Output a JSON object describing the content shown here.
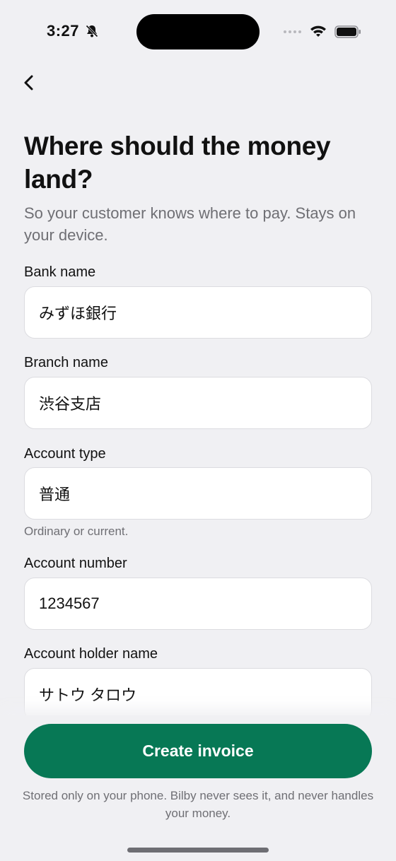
{
  "status_bar": {
    "time": "3:27",
    "icons": [
      "bell-slash-icon",
      "signal-dots-icon",
      "wifi-icon",
      "battery-icon"
    ]
  },
  "nav": {
    "back_icon": "chevron-left-icon"
  },
  "header": {
    "title": "Where should the money land?",
    "subtitle": "So your customer knows where to pay. Stays on your device."
  },
  "form": {
    "bank_name": {
      "label": "Bank name",
      "value": "みずほ銀行"
    },
    "branch_name": {
      "label": "Branch name",
      "value": "渋谷支店"
    },
    "account_type": {
      "label": "Account type",
      "value": "普通",
      "hint": "Ordinary or current."
    },
    "account_number": {
      "label": "Account number",
      "value": "1234567"
    },
    "account_holder": {
      "label": "Account holder name",
      "value": "サトウ タロウ"
    }
  },
  "footer": {
    "cta_label": "Create invoice",
    "note": "Stored only on your phone. Bilby never sees it, and never handles your money."
  },
  "colors": {
    "background": "#f0f0f3",
    "accent": "#077855",
    "muted_text": "#6f6f74",
    "input_border": "#dcdce0"
  }
}
